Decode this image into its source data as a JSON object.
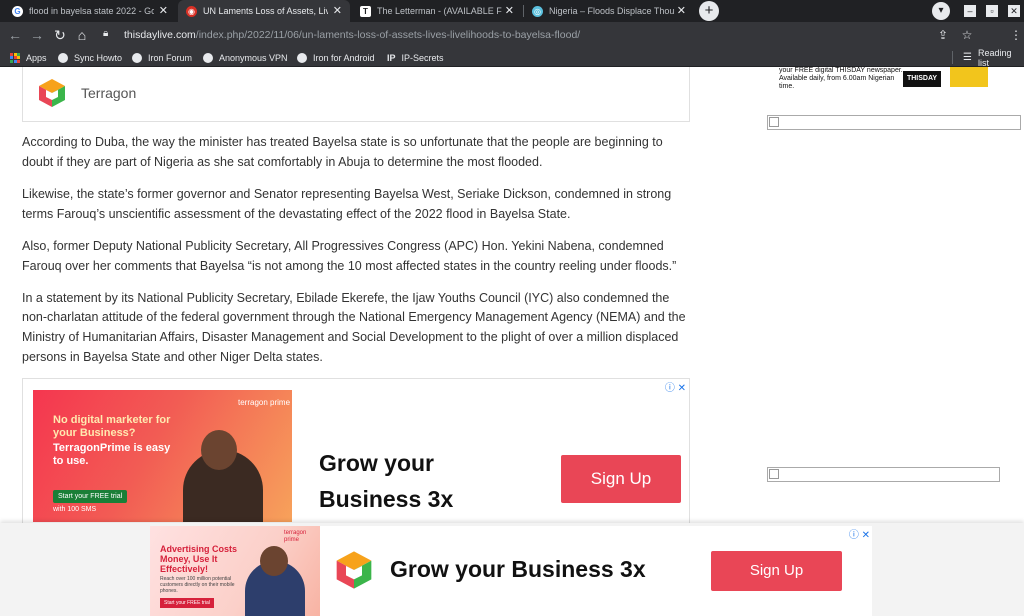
{
  "tabs": [
    {
      "title": "flood in bayelsa state 2022 - Goo",
      "favicon": "google-icon",
      "active": false
    },
    {
      "title": "UN Laments Loss of Assets, Lives,",
      "favicon": "thisday-icon",
      "active": true
    },
    {
      "title": "The Letterman - (AVAILABLE FRO",
      "favicon": "letterman-icon",
      "active": false
    },
    {
      "title": "Nigeria – Floods Displace Thous",
      "favicon": "reliefweb-icon",
      "active": false
    }
  ],
  "address_bar": {
    "host": "thisdaylive.com",
    "path": "/index.php/2022/11/06/un-laments-loss-of-assets-lives-livelihoods-to-bayelsa-flood/"
  },
  "bookmarks": [
    "Apps",
    "Sync Howto",
    "Iron Forum",
    "Anonymous VPN",
    "Iron for Android",
    "IP-Secrets"
  ],
  "reading_list": "Reading list",
  "terragon_box": {
    "name": "Terragon"
  },
  "article": {
    "paragraphs": [
      "According to Duba, the way the minister has treated Bayelsa state is so unfortunate that the people are beginning to doubt if they are part of Nigeria as she sat comfortably in Abuja to determine the most flooded.",
      "Likewise, the state’s former governor and Senator representing Bayelsa West, Seriake Dickson, condemned in strong terms Farouq’s unscientific assessment of the devastating effect of the 2022 flood in Bayelsa State.",
      "Also, former Deputy National Publicity Secretary, All Progressives Congress (APC) Hon. Yekini Nabena, condemned Farouq over her comments that Bayelsa “is not among the 10 most affected states in the country reeling under floods.”",
      "In a statement by its National Publicity Secretary, Ebilade Ekerefe, the Ijaw Youths Council (IYC) also condemned the non-charlatan attitude of the federal government through the National Emergency Management Agency (NEMA) and the Ministry of Humanitarian Affairs, Disaster Management and Social Development to the plight of over a million displaced persons in Bayelsa State and other Niger Delta states."
    ]
  },
  "inline_ad": {
    "image_headline": "No digital marketer for your Business?",
    "image_subhead": "TerragonPrime is easy to use.",
    "image_trial": "Start your FREE trial",
    "image_sms": "with 100 SMS",
    "image_brand": "terragon prime",
    "headline_line1": "Grow your",
    "headline_line2": "Business 3x",
    "cta": "Sign Up",
    "choices": "ⓘ ✕"
  },
  "sidebar": {
    "promo_text": "your FREE digital THISDAY newspaper. Available daily, from 6.00am Nigerian time.",
    "brand": "THISDAY"
  },
  "anchor_ad": {
    "image_headline": "Advertising Costs Money, Use It Effectively!",
    "image_small": "Reach over 100 million potential customers directly on their mobile phones.",
    "image_trial": "Start your FREE trial",
    "image_brand": "terragon prime",
    "headline": "Grow your Business 3x",
    "cta": "Sign Up",
    "choices": "ⓘ ✕"
  },
  "colors": {
    "accent_red": "#e94656",
    "chrome_dark": "#35363a",
    "chrome_darker": "#202124"
  }
}
